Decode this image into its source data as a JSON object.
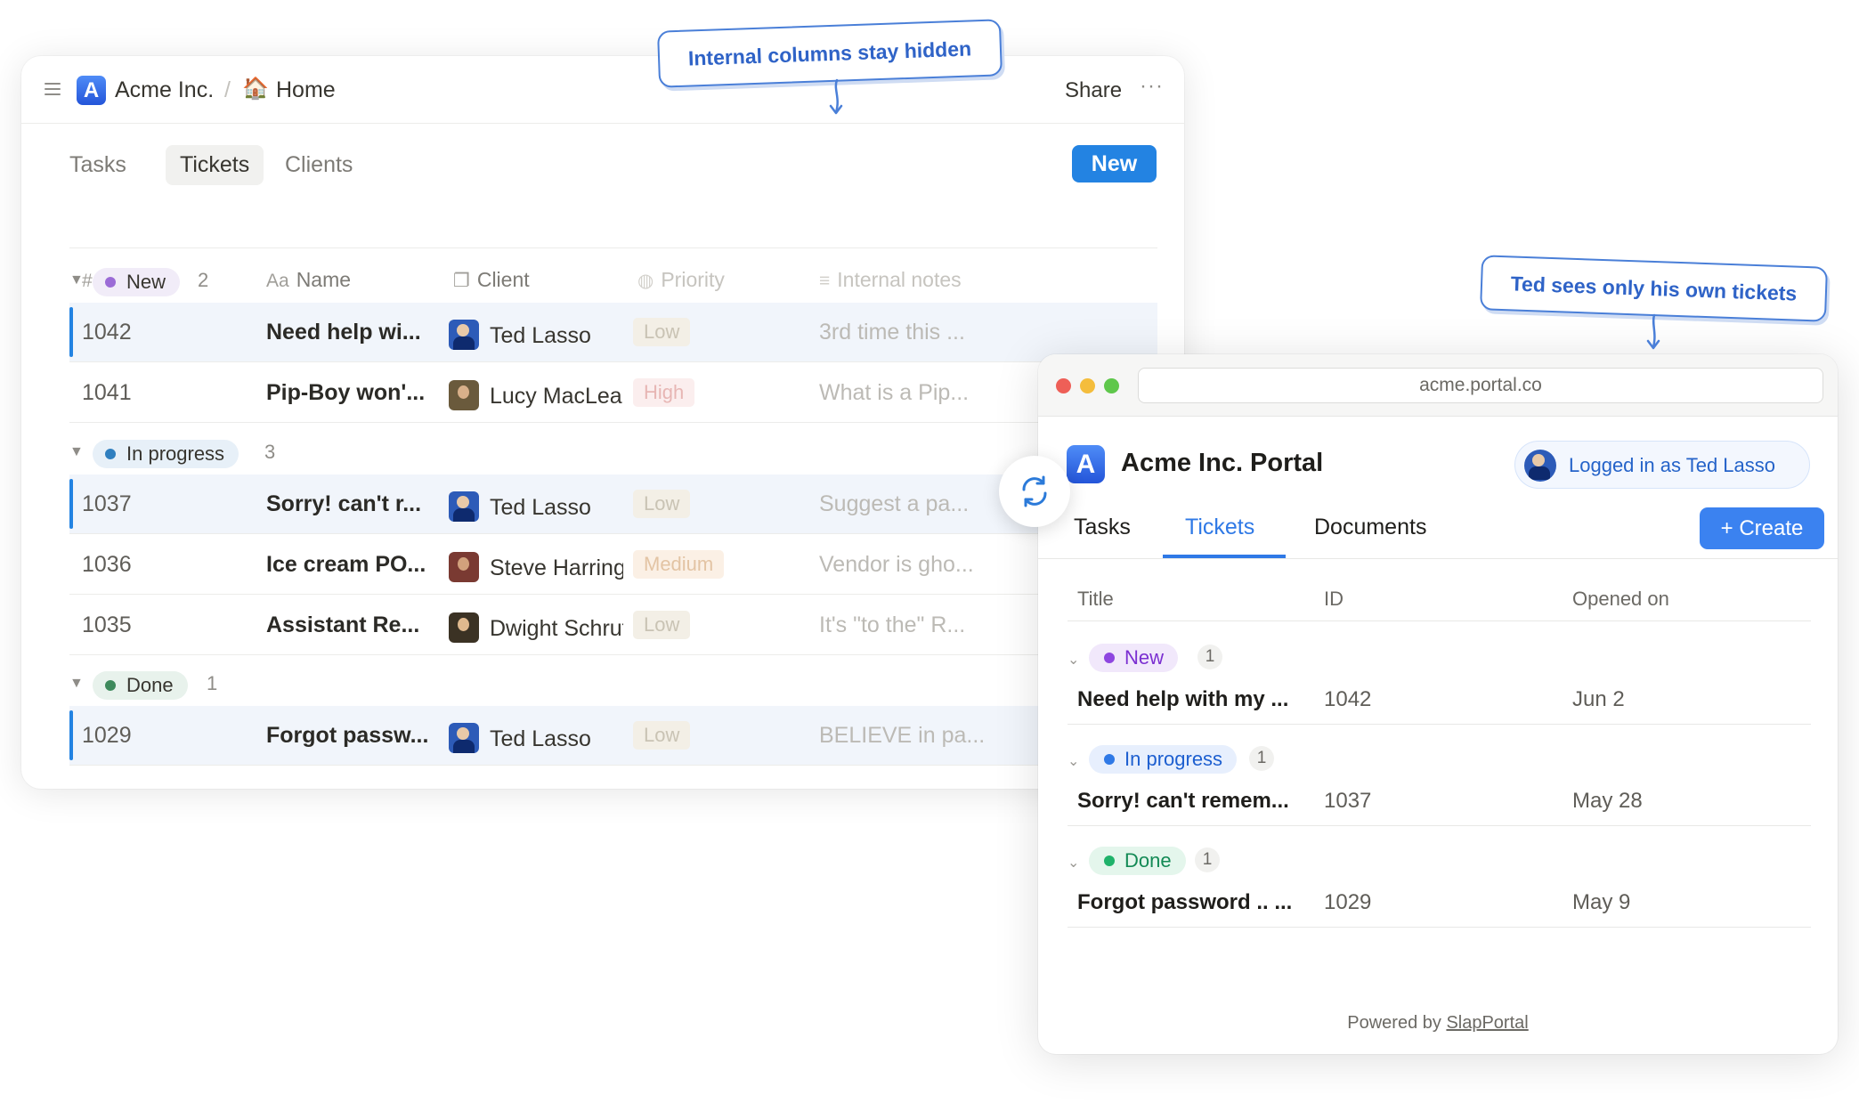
{
  "left_app": {
    "workspace": "Acme Inc.",
    "separator": "/",
    "page_icon": "🏠",
    "page": "Home",
    "share_label": "Share",
    "more_label": "···",
    "tabs": [
      "Tasks",
      "Tickets",
      "Clients"
    ],
    "active_tab": "Tickets",
    "new_label": "New",
    "columns": [
      {
        "icon": "#",
        "label": "ID"
      },
      {
        "icon": "Aa",
        "label": "Name"
      },
      {
        "icon": "❐",
        "label": "Client"
      },
      {
        "icon": "◍",
        "label": "Priority"
      },
      {
        "icon": "≡",
        "label": "Internal notes"
      }
    ],
    "groups": [
      {
        "label": "New",
        "count": "2",
        "rows": [
          {
            "id": "1042",
            "name": "Need help wi...",
            "client": "Ted Lasso",
            "priority": "Low",
            "notes": "3rd time this ..."
          },
          {
            "id": "1041",
            "name": "Pip-Boy won'...",
            "client": "Lucy MacLean",
            "priority": "High",
            "notes": "What is a Pip..."
          }
        ]
      },
      {
        "label": "In progress",
        "count": "3",
        "rows": [
          {
            "id": "1037",
            "name": "Sorry! can't r...",
            "client": "Ted Lasso",
            "priority": "Low",
            "notes": "Suggest a pa..."
          },
          {
            "id": "1036",
            "name": "Ice cream PO...",
            "client": "Steve Harrington",
            "priority": "Medium",
            "notes": "Vendor is gho..."
          },
          {
            "id": "1035",
            "name": "Assistant Re...",
            "client": "Dwight Schrute",
            "priority": "Low",
            "notes": "It's \"to the\" R..."
          }
        ]
      },
      {
        "label": "Done",
        "count": "1",
        "rows": [
          {
            "id": "1029",
            "name": "Forgot passw...",
            "client": "Ted Lasso",
            "priority": "Low",
            "notes": "BELIEVE in pa..."
          }
        ]
      }
    ]
  },
  "portal": {
    "url": "acme.portal.co",
    "title": "Acme Inc. Portal",
    "logged_in": "Logged in as Ted Lasso",
    "tabs": [
      "Tasks",
      "Tickets",
      "Documents"
    ],
    "active_tab": "Tickets",
    "create_label": "+ Create",
    "columns": [
      "Title",
      "ID",
      "Opened on"
    ],
    "groups": [
      {
        "label": "New",
        "count": "1",
        "row": {
          "title": "Need help with my ...",
          "id": "1042",
          "date": "Jun 2"
        }
      },
      {
        "label": "In progress",
        "count": "1",
        "row": {
          "title": "Sorry! can't remem...",
          "id": "1037",
          "date": "May 28"
        }
      },
      {
        "label": "Done",
        "count": "1",
        "row": {
          "title": "Forgot password .. ...",
          "id": "1029",
          "date": "May 9"
        }
      }
    ],
    "powered_prefix": "Powered by ",
    "powered_link": "SlapPortal"
  },
  "callouts": {
    "left": "Internal columns stay hidden",
    "right": "Ted sees only his own tickets"
  },
  "colors": {
    "accent": "#2383e2",
    "new_dot": "#9b6bd6",
    "progress_dot": "#2f7fbf",
    "done_dot": "#3e8a5c",
    "portal_new_text": "#7b2fd1",
    "portal_progress_text": "#1d5fd0",
    "portal_done_text": "#138a55"
  }
}
